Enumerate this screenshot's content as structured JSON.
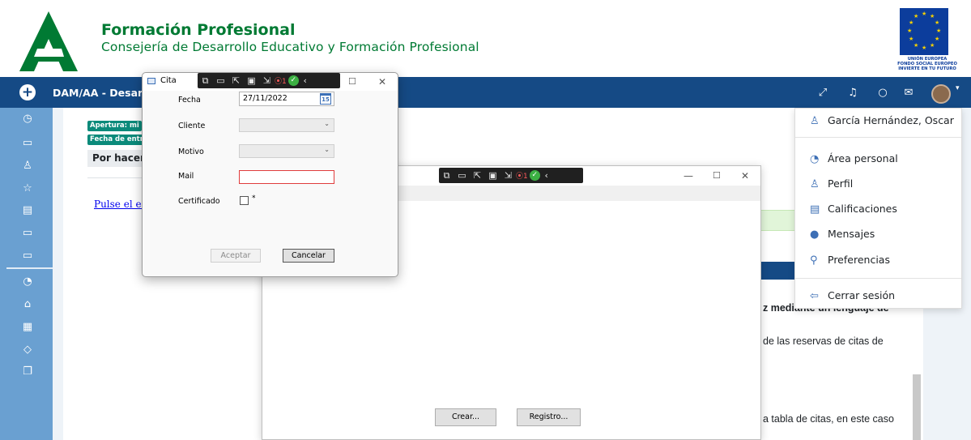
{
  "header": {
    "title": "Formación Profesional",
    "subtitle": "Consejería de Desarrollo Educativo y Formación Profesional",
    "eu_line1": "UNIÓN EUROPEA",
    "eu_line2": "FONDO SOCIAL EUROPEO",
    "eu_line3": "INVIERTE EN TU FUTURO"
  },
  "navbar": {
    "course_title": "DAM/AA - Desarrol",
    "icons": [
      "expand-icon",
      "bell-icon",
      "chat-icon",
      "mail-icon",
      "avatar"
    ],
    "glyph_expand": "⤢",
    "glyph_bell": "♫",
    "glyph_chat": "○",
    "glyph_mail": "✉"
  },
  "sidebar": {
    "icons": [
      "clock-icon",
      "folder-icon",
      "users-icon",
      "star-icon",
      "book-icon",
      "folder-icon",
      "folder-icon",
      "dashboard-icon",
      "home-icon",
      "calendar-icon",
      "graduation-icon",
      "files-icon"
    ],
    "glyphs": [
      "◷",
      "▭",
      "♙",
      "☆",
      "▤",
      "▭",
      "▭",
      "◔",
      "⌂",
      "▦",
      "◇",
      "❐"
    ]
  },
  "main": {
    "badge1": "Apertura: mi",
    "badge2": "Fecha de entre",
    "todo_label": "Por hacer:",
    "link_text": "Pulse el enla",
    "text1": "z mediante un lenguaje de",
    "text2": "de las reservas de citas de",
    "text3": "a tabla de citas, en este caso"
  },
  "user_menu": {
    "user_name": "García Hernández, Oscar",
    "items": [
      {
        "label": "Área personal",
        "icon": "dashboard-icon",
        "glyph": "◔"
      },
      {
        "label": "Perfil",
        "icon": "user-icon",
        "glyph": "♙"
      },
      {
        "label": "Calificaciones",
        "icon": "grades-icon",
        "glyph": "▤"
      },
      {
        "label": "Mensajes",
        "icon": "message-icon",
        "glyph": "●"
      },
      {
        "label": "Preferencias",
        "icon": "wrench-icon",
        "glyph": "⚲"
      }
    ],
    "logout": "Cerrar sesión",
    "user_glyph": "♙",
    "logout_glyph": "⇦"
  },
  "bg_window": {
    "debug_count": "1",
    "crear_label": "Crear...",
    "registro_label": "Registro...",
    "minimize": "—",
    "maximize": "☐",
    "close": "✕"
  },
  "cita_dialog": {
    "title": "Cita",
    "debug_count": "1",
    "fields": {
      "fecha_label": "Fecha",
      "fecha_value": "27/11/2022",
      "calendar_day": "15",
      "cliente_label": "Cliente",
      "motivo_label": "Motivo",
      "mail_label": "Mail",
      "certificado_label": "Certificado",
      "required_mark": "*"
    },
    "aceptar_label": "Aceptar",
    "cancelar_label": "Cancelar",
    "maximize": "☐",
    "close": "✕"
  }
}
